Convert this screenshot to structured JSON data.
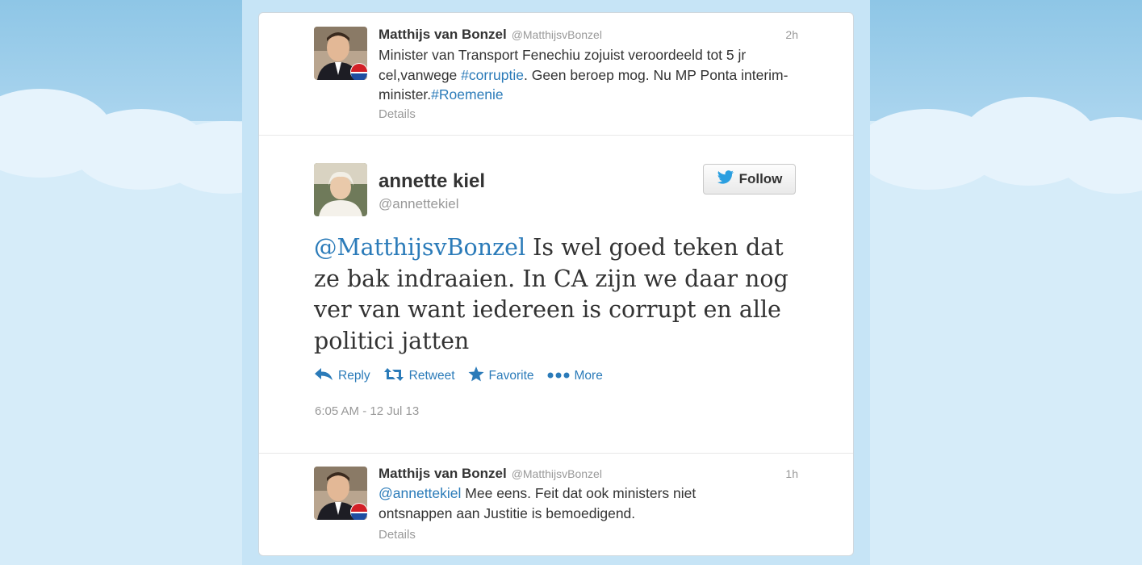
{
  "tweets": {
    "first": {
      "name": "Matthijs van Bonzel",
      "handle": "@MatthijsvBonzel",
      "time": "2h",
      "text_parts": [
        "Minister van Transport Fenechiu zojuist veroordeeld tot 5 jr cel,vanwege ",
        "#corruptie",
        ". Geen beroep mog. Nu MP Ponta interim-minister.",
        "#Roemenie"
      ],
      "details": "Details"
    },
    "main": {
      "name": "annette kiel",
      "handle": "@annettekiel",
      "follow_label": "Follow",
      "mention": "@MatthijsvBonzel",
      "text": " Is wel goed teken dat ze bak indraaien. In CA zijn we daar nog ver van want iedereen is corrupt en alle politici jatten",
      "actions": {
        "reply": "Reply",
        "retweet": "Retweet",
        "favorite": "Favorite",
        "more": "More"
      },
      "timestamp": "6:05 AM - 12 Jul 13"
    },
    "reply": {
      "name": "Matthijs van Bonzel",
      "handle": "@MatthijsvBonzel",
      "time": "1h",
      "mention": "@annettekiel",
      "text": " Mee eens. Feit dat ook ministers niet ontsnappen aan Justitie is bemoedigend.",
      "details": "Details"
    }
  },
  "colors": {
    "link": "#2b7bb9",
    "background": "#c4e2f5"
  },
  "icons": [
    "bird-icon",
    "reply-icon",
    "retweet-icon",
    "star-icon",
    "more-dots-icon"
  ]
}
